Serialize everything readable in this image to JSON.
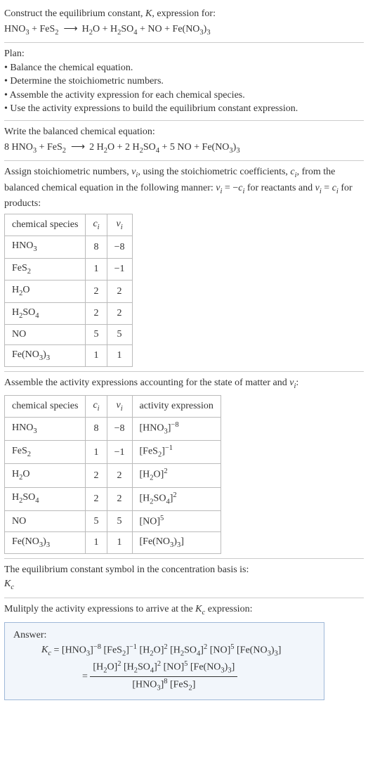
{
  "intro": {
    "line1": "Construct the equilibrium constant, K, expression for:",
    "eq_lhs": "HNO₃ + FeS₂",
    "arrow": "⟶",
    "eq_rhs": "H₂O + H₂SO₄ + NO + Fe(NO₃)₃"
  },
  "plan": {
    "title": "Plan:",
    "items": [
      "• Balance the chemical equation.",
      "• Determine the stoichiometric numbers.",
      "• Assemble the activity expression for each chemical species.",
      "• Use the activity expressions to build the equilibrium constant expression."
    ]
  },
  "balanced": {
    "title": "Write the balanced chemical equation:",
    "lhs": "8 HNO₃ + FeS₂",
    "arrow": "⟶",
    "rhs": "2 H₂O + 2 H₂SO₄ + 5 NO + Fe(NO₃)₃"
  },
  "stoich_intro": "Assign stoichiometric numbers, νᵢ, using the stoichiometric coefficients, cᵢ, from the balanced chemical equation in the following manner: νᵢ = −cᵢ for reactants and νᵢ = cᵢ for products:",
  "table1": {
    "headers": [
      "chemical species",
      "cᵢ",
      "νᵢ"
    ],
    "rows": [
      [
        "HNO₃",
        "8",
        "−8"
      ],
      [
        "FeS₂",
        "1",
        "−1"
      ],
      [
        "H₂O",
        "2",
        "2"
      ],
      [
        "H₂SO₄",
        "2",
        "2"
      ],
      [
        "NO",
        "5",
        "5"
      ],
      [
        "Fe(NO₃)₃",
        "1",
        "1"
      ]
    ]
  },
  "activity_intro": "Assemble the activity expressions accounting for the state of matter and νᵢ:",
  "table2": {
    "headers": [
      "chemical species",
      "cᵢ",
      "νᵢ",
      "activity expression"
    ],
    "rows": [
      {
        "sp": "HNO₃",
        "c": "8",
        "v": "−8",
        "a": "[HNO₃]⁻⁸"
      },
      {
        "sp": "FeS₂",
        "c": "1",
        "v": "−1",
        "a": "[FeS₂]⁻¹"
      },
      {
        "sp": "H₂O",
        "c": "2",
        "v": "2",
        "a": "[H₂O]²"
      },
      {
        "sp": "H₂SO₄",
        "c": "2",
        "v": "2",
        "a": "[H₂SO₄]²"
      },
      {
        "sp": "NO",
        "c": "5",
        "v": "5",
        "a": "[NO]⁵"
      },
      {
        "sp": "Fe(NO₃)₃",
        "c": "1",
        "v": "1",
        "a": "[Fe(NO₃)₃]"
      }
    ]
  },
  "kc_intro": "The equilibrium constant symbol in the concentration basis is:",
  "kc_symbol": "K_c",
  "multiply_intro": "Mulitply the activity expressions to arrive at the K_c expression:",
  "answer": {
    "label": "Answer:",
    "line1_lhs": "K_c =",
    "line1_rhs": "[HNO₃]⁻⁸ [FeS₂]⁻¹ [H₂O]² [H₂SO₄]² [NO]⁵ [Fe(NO₃)₃]",
    "eq2": "=",
    "frac_num": "[H₂O]² [H₂SO₄]² [NO]⁵ [Fe(NO₃)₃]",
    "frac_den": "[HNO₃]⁸ [FeS₂]"
  },
  "chart_data": {
    "type": "table",
    "tables": [
      {
        "title": "Stoichiometric numbers",
        "headers": [
          "chemical species",
          "c_i",
          "ν_i"
        ],
        "rows": [
          [
            "HNO3",
            8,
            -8
          ],
          [
            "FeS2",
            1,
            -1
          ],
          [
            "H2O",
            2,
            2
          ],
          [
            "H2SO4",
            2,
            2
          ],
          [
            "NO",
            5,
            5
          ],
          [
            "Fe(NO3)3",
            1,
            1
          ]
        ]
      },
      {
        "title": "Activity expressions",
        "headers": [
          "chemical species",
          "c_i",
          "ν_i",
          "activity expression"
        ],
        "rows": [
          [
            "HNO3",
            8,
            -8,
            "[HNO3]^-8"
          ],
          [
            "FeS2",
            1,
            -1,
            "[FeS2]^-1"
          ],
          [
            "H2O",
            2,
            2,
            "[H2O]^2"
          ],
          [
            "H2SO4",
            2,
            2,
            "[H2SO4]^2"
          ],
          [
            "NO",
            5,
            5,
            "[NO]^5"
          ],
          [
            "Fe(NO3)3",
            1,
            1,
            "[Fe(NO3)3]"
          ]
        ]
      }
    ]
  }
}
